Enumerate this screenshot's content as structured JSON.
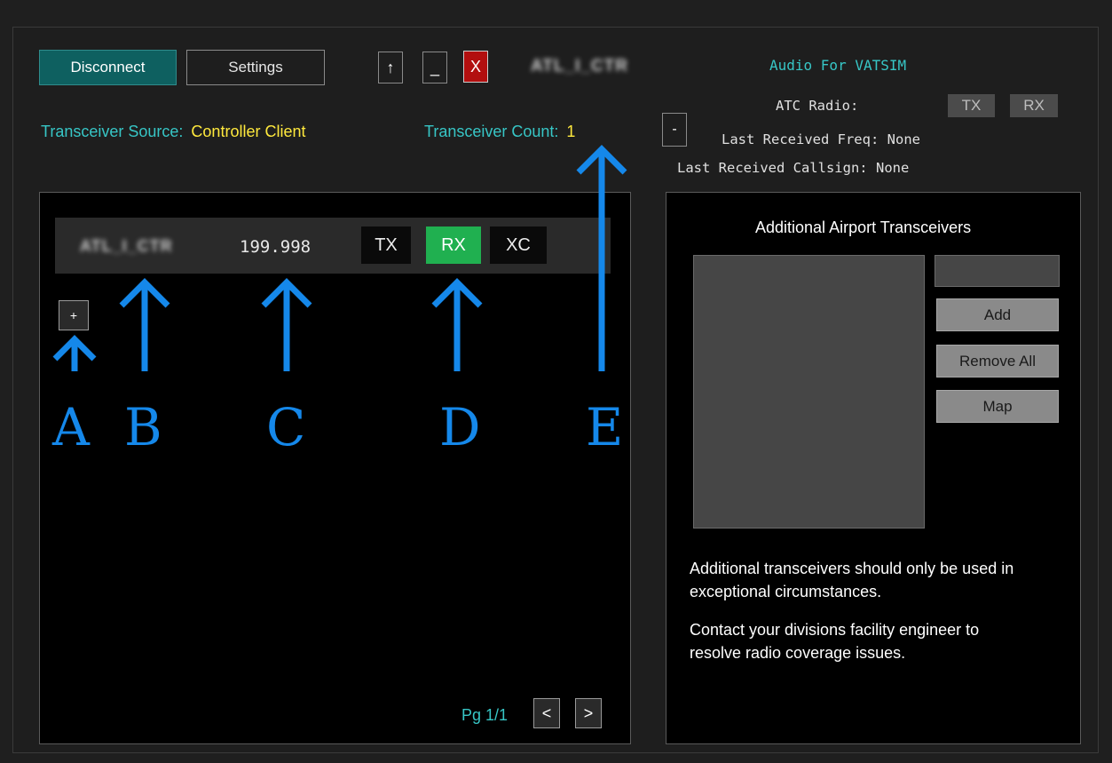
{
  "toolbar": {
    "disconnect_label": "Disconnect",
    "settings_label": "Settings",
    "up_label": "↑",
    "minimize_label": "_",
    "close_label": "X",
    "callsign_blurred": "ATL_I_CTR"
  },
  "audio": {
    "title": "Audio For VATSIM",
    "atc_radio_label": "ATC Radio:",
    "tx_label": "TX",
    "rx_label": "RX",
    "last_freq_label": "Last Received Freq:",
    "last_freq_value": "None",
    "last_callsign_label": "Last Received Callsign:",
    "last_callsign_value": "None"
  },
  "transceiver": {
    "source_label": "Transceiver Source:",
    "source_value": "Controller Client",
    "count_label": "Transceiver Count:",
    "count_value": "1",
    "collapse_label": "-"
  },
  "station_row": {
    "callsign_blurred": "ATL_I_CTR",
    "frequency": "199.998",
    "tx_label": "TX",
    "rx_label": "RX",
    "xc_label": "XC",
    "add_label": "+"
  },
  "annotations": [
    "A",
    "B",
    "C",
    "D",
    "E"
  ],
  "pager": {
    "page_text": "Pg 1/1",
    "prev_label": "<",
    "next_label": ">"
  },
  "airport_panel": {
    "title": "Additional Airport Transceivers",
    "input_value": "",
    "add_label": "Add",
    "remove_all_label": "Remove All",
    "map_label": "Map",
    "note1": "Additional transceivers should only be used in exceptional circumstances.",
    "note2": "Contact your divisions facility engineer to resolve radio coverage issues."
  },
  "colors": {
    "accent_teal": "#37c6c6",
    "value_yellow": "#ffe93d",
    "active_green": "#20b050",
    "close_red": "#b20f0f",
    "annotation_blue": "#1588ea"
  }
}
